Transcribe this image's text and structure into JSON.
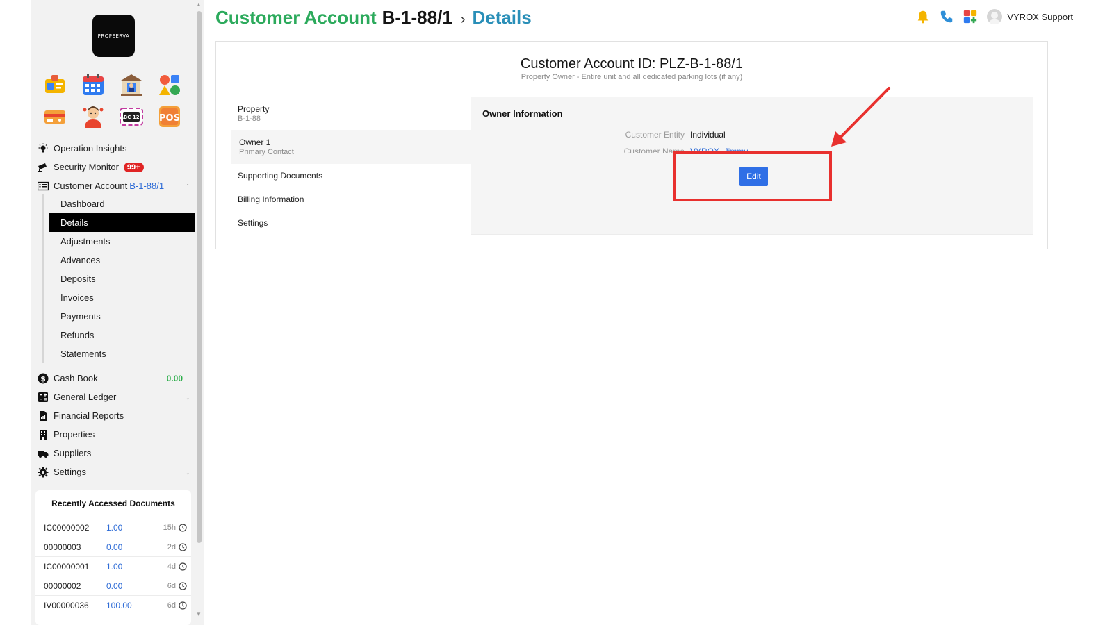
{
  "brand": {
    "logo_text": "PROPEERVA"
  },
  "apps": [
    {
      "icon": "id-card-app-icon"
    },
    {
      "icon": "calendar-app-icon"
    },
    {
      "icon": "building-app-icon"
    },
    {
      "icon": "shapes-app-icon"
    },
    {
      "icon": "ticket-app-icon"
    },
    {
      "icon": "person-app-icon"
    },
    {
      "icon": "abc123-app-icon",
      "text": "ABC 123"
    },
    {
      "icon": "pos-app-icon",
      "text": "POS"
    }
  ],
  "sidebar": {
    "items": [
      {
        "label": "Operation Insights",
        "icon": "lightbulb-icon"
      },
      {
        "label": "Security Monitor",
        "icon": "cctv-icon",
        "badge": "99+"
      },
      {
        "label": "Customer Account",
        "account": "B-1-88/1",
        "icon": "account-list-icon",
        "arrow": "↑"
      }
    ],
    "sub_items": [
      "Dashboard",
      "Details",
      "Adjustments",
      "Advances",
      "Deposits",
      "Invoices",
      "Payments",
      "Refunds",
      "Statements"
    ],
    "active_sub": "Details",
    "items2": [
      {
        "label": "Cash Book",
        "icon": "dollar-circle-icon",
        "value": "0.00"
      },
      {
        "label": "General Ledger",
        "icon": "calculator-icon",
        "arrow": "↓"
      },
      {
        "label": "Financial Reports",
        "icon": "report-icon"
      },
      {
        "label": "Properties",
        "icon": "building-icon"
      },
      {
        "label": "Suppliers",
        "icon": "truck-icon"
      },
      {
        "label": "Settings",
        "icon": "gear-icon",
        "arrow": "↓"
      }
    ]
  },
  "recent": {
    "title": "Recently Accessed Documents",
    "rows": [
      {
        "id": "IC00000002",
        "amount": "1.00",
        "ago": "15h"
      },
      {
        "id": "00000003",
        "amount": "0.00",
        "ago": "2d"
      },
      {
        "id": "IC00000001",
        "amount": "1.00",
        "ago": "4d"
      },
      {
        "id": "00000002",
        "amount": "0.00",
        "ago": "6d"
      },
      {
        "id": "IV00000036",
        "amount": "100.00",
        "ago": "6d"
      }
    ]
  },
  "header": {
    "crumb_section": "Customer Account",
    "crumb_account": "B-1-88/1",
    "crumb_sep": "›",
    "crumb_page": "Details",
    "user": "VYROX Support"
  },
  "card": {
    "title": "Customer Account ID: PLZ-B-1-88/1",
    "subtitle": "Property Owner - Entire unit and all dedicated parking lots (if any)",
    "tabs": [
      {
        "label": "Property",
        "sub": "B-1-88"
      },
      {
        "label": "Owner 1",
        "sub": "Primary Contact"
      },
      {
        "label": "Supporting Documents"
      },
      {
        "label": "Billing Information"
      },
      {
        "label": "Settings"
      }
    ]
  },
  "owner_panel": {
    "title": "Owner Information",
    "entity_label": "Customer Entity",
    "entity_value": "Individual",
    "name_label": "Customer Name",
    "name_value": "VYROX, Jimmy",
    "edit_label": "Edit"
  },
  "colors": {
    "accent_green": "#2caa5c",
    "accent_blue": "#2a8fb8",
    "button_blue": "#2f6fe6",
    "annotation_red": "#e8302e",
    "badge_red": "#e02424"
  }
}
